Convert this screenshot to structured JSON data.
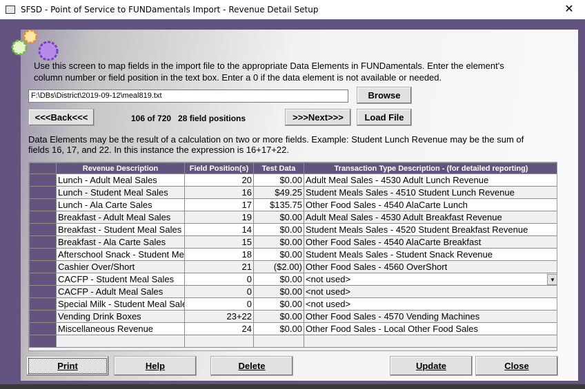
{
  "window": {
    "title": "SFSD - Point of Service to FUNDamentals Import - Revenue Detail Setup",
    "close": "✕"
  },
  "intro": "Use this screen to map fields in the import file to the appropriate Data Elements in FUNDamentals. Enter the element's column number or field position in the text box. Enter a 0 if the data element is not available or needed.",
  "file_path": "F:\\DBs\\District\\2019-09-12\\meal819.txt",
  "buttons": {
    "browse": "Browse",
    "back": "<<<Back<<<",
    "next": ">>>Next>>>",
    "load_file": "Load File",
    "print": "Print",
    "help": "Help",
    "delete": "Delete",
    "update": "Update",
    "close": "Close"
  },
  "counter": "106 of 720   28 field positions",
  "note": "Data Elements may be the result of a calculation on two or more fields. Example: Student Lunch Revenue may be the sum of fields 16, 17, and 22. In this instance the expression is 16+17+22.",
  "table": {
    "headers": [
      "Revenue Description",
      "Field Position(s)",
      "Test Data",
      "Transaction Type Description - (for detailed reporting)"
    ],
    "rows": [
      [
        "Lunch - Adult Meal Sales",
        "20",
        "$0.00",
        "Adult Meal Sales - 4530 Adult Lunch Revenue"
      ],
      [
        "Lunch - Student Meal Sales",
        "16",
        "$49.25",
        "Student Meals Sales - 4510 Student Lunch Revenue"
      ],
      [
        "Lunch - Ala Carte Sales",
        "17",
        "$135.75",
        "Other Food Sales - 4540 AlaCarte Lunch"
      ],
      [
        "Breakfast - Adult Meal Sales",
        "19",
        "$0.00",
        "Adult Meal Sales - 4530 Adult Breakfast Revenue"
      ],
      [
        "Breakfast - Student Meal Sales",
        "14",
        "$0.00",
        "Student Meals Sales - 4520 Student Breakfast Revenue"
      ],
      [
        "Breakfast - Ala Carte Sales",
        "15",
        "$0.00",
        "Other Food Sales - 4540 AlaCarte Breakfast"
      ],
      [
        "Afterschool Snack - Student Meal Sales",
        "18",
        "$0.00",
        "Student Meals Sales - Student Snack Revenue"
      ],
      [
        "Cashier Over/Short",
        "21",
        "($2.00)",
        "Other Food Sales - 4560 OverShort"
      ],
      [
        "CACFP - Student Meal Sales",
        "0",
        "$0.00",
        "<not used>"
      ],
      [
        "CACFP - Adult Meal Sales",
        "0",
        "$0.00",
        "<not used>"
      ],
      [
        "Special Milk - Student Meal Sales",
        "0",
        "$0.00",
        "<not used>"
      ],
      [
        "Vending Drink Boxes",
        "23+22",
        "$0.00",
        "Other Food Sales - 4570 Vending Machines"
      ],
      [
        "Miscellaneous Revenue",
        "24",
        "$0.00",
        "Other Food Sales - Local Other Food Sales"
      ]
    ]
  }
}
